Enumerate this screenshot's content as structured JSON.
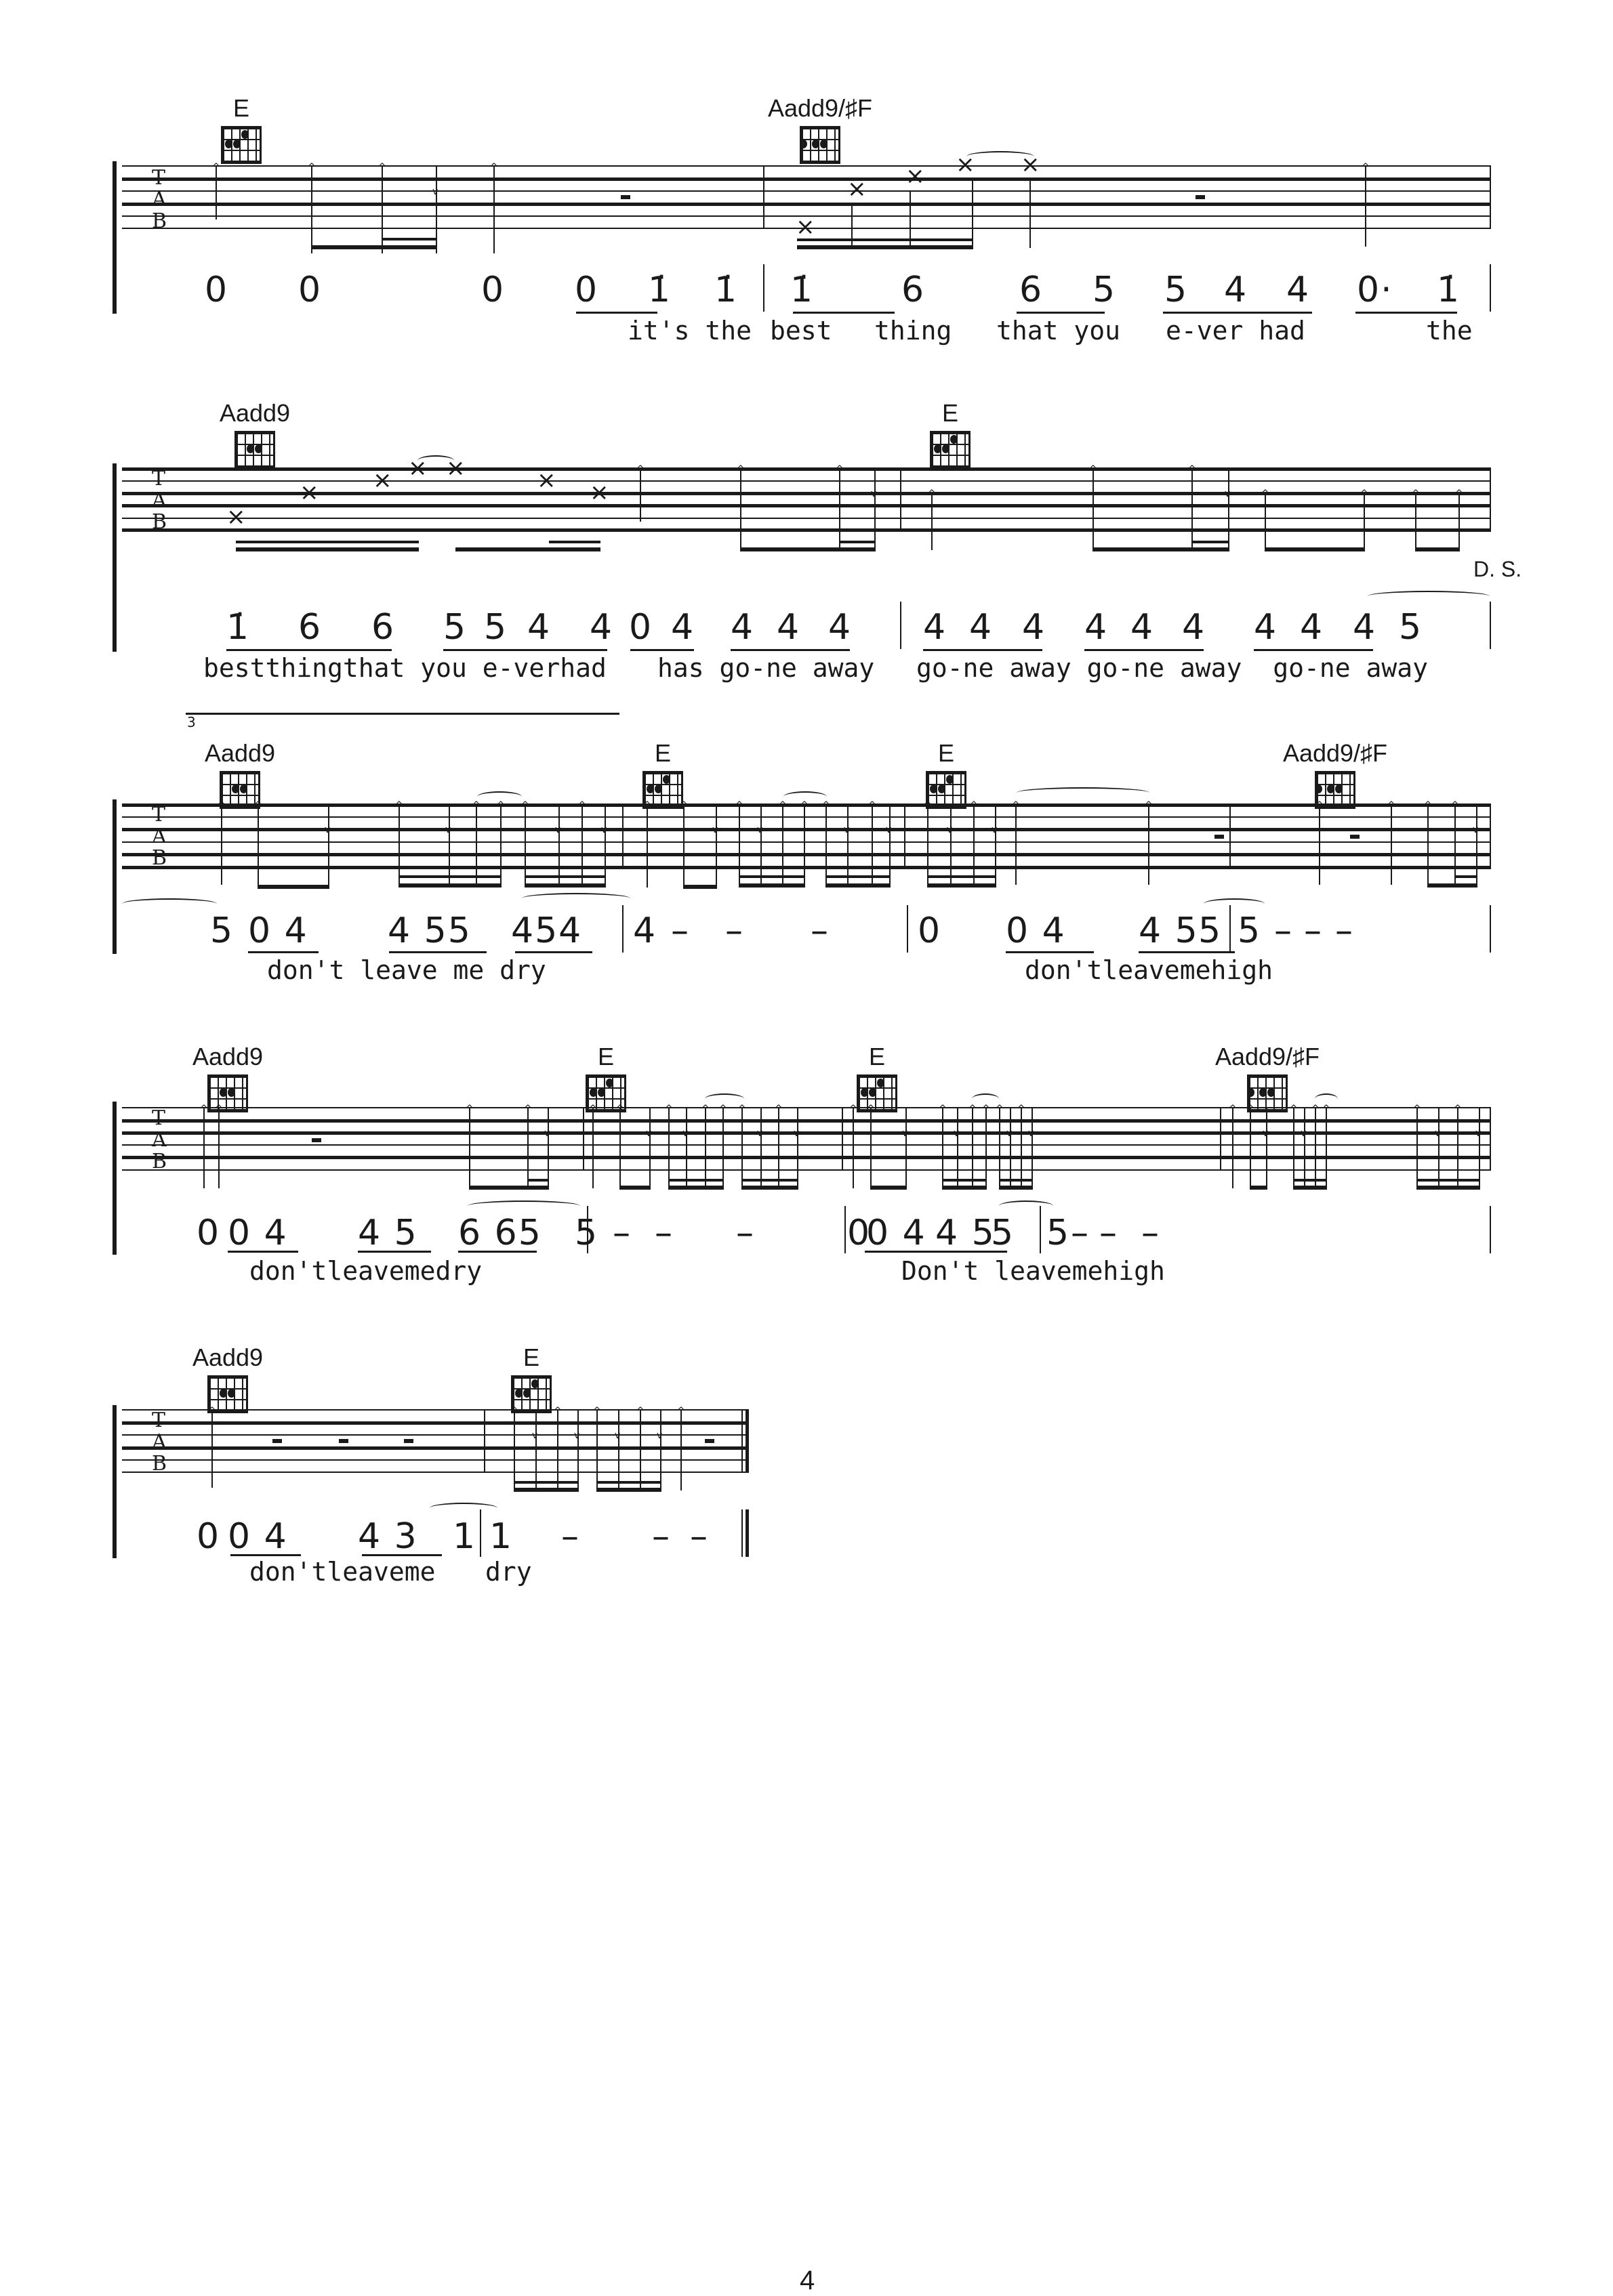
{
  "page": {
    "page_number": "4",
    "tab_clef": [
      "T",
      "A",
      "B"
    ],
    "ds_marking": "D. S.",
    "triplet_label": "3"
  },
  "systems": [
    {
      "chords": [
        {
          "name": "E",
          "diagram": "E"
        },
        {
          "name": "Aadd9/♯F",
          "diagram": "Aadd9/F#"
        }
      ],
      "measures": [
        {
          "notes": "0    0        0    0   i   i",
          "lyrics": "it's the best"
        },
        {
          "notes": "i     6     6   5   5  4   4   0·   i",
          "lyrics": "best   thing   that you   e-ver had        the"
        }
      ],
      "number_line": "0    0        0    0  1̇  1̇  | 1̇   6   6  5  5 4  4  0·  1̇",
      "lyric_line": "it's the  best   thing   that you   e-ver had       the"
    },
    {
      "chords": [
        {
          "name": "Aadd9",
          "diagram": "Aadd9"
        },
        {
          "name": "E",
          "diagram": "E"
        }
      ],
      "number_line": "1̇  6  6   5 5 4 4 0 4  4 4 4   | 4 4 4  4 4 4   4 4 4 5",
      "lyric_line": "bestthingthat you e-verhad  has go-ne away   go-ne away go-ne away  go-ne away",
      "ds": "D. S."
    },
    {
      "chords": [
        {
          "name": "Aadd9",
          "diagram": "Aadd9"
        },
        {
          "name": "E",
          "diagram": "E"
        },
        {
          "name": "E",
          "diagram": "E"
        },
        {
          "name": "Aadd9/♯F",
          "diagram": "Aadd9/F#"
        }
      ],
      "number_line": "5 0  4    4  55  454 | 4 –  –   –   | 0    0  4    4   5  5 | 5 – – –",
      "lyric_line": "don't leave me dry                       don'tleavemehigh"
    },
    {
      "chords": [
        {
          "name": "Aadd9",
          "diagram": "Aadd9"
        },
        {
          "name": "E",
          "diagram": "E"
        },
        {
          "name": "E",
          "diagram": "E"
        },
        {
          "name": "Aadd9/♯F",
          "diagram": "Aadd9/F#"
        }
      ],
      "number_line": "0 0  4    4  5  6 65 | 5 –  –   –  | 0 0  4    4  5  5  | 5 –  –   –",
      "lyric_line": "don'tleavemedry                  Don't leavemehigh"
    },
    {
      "chords": [
        {
          "name": "Aadd9",
          "diagram": "Aadd9"
        },
        {
          "name": "E",
          "diagram": "E"
        }
      ],
      "number_line": "0 0  4    4  31 | 1   –   – –",
      "lyric_line": "don'tleaveme  dry"
    }
  ],
  "text": {
    "s1_n": [
      "0",
      "0",
      "0",
      "0",
      "1̇",
      "1̇",
      "1̇",
      "6",
      "6",
      "5",
      "5",
      "4",
      "4",
      "0·",
      "1̇"
    ],
    "s1_l1": "it's the",
    "s1_l2": "best",
    "s1_l3": "thing",
    "s1_l4": "that you",
    "s1_l5": "e-ver had",
    "s1_l6": "the",
    "s2_n": [
      "1̇",
      "6",
      "6",
      "5",
      "5",
      "4",
      "4",
      "0",
      "4",
      "4",
      "4",
      "4",
      "4",
      "4",
      "4",
      "4",
      "4",
      "4",
      "4",
      "4",
      "4",
      "5"
    ],
    "s2_l1": "bestthingthat you e-verhad",
    "s2_l2": "has go-ne away",
    "s2_l3": "go-ne away go-ne away  go-ne away",
    "s3_n1": "5",
    "s3_n2": "0 4",
    "s3_n3": "4 55",
    "s3_n4": "454",
    "s3_n5": "4",
    "s3_n6": "–",
    "s3_n7": "0",
    "s3_n8": "0 4",
    "s3_n9": "4 5",
    "s3_n10": "5",
    "s3_n11": "5",
    "s3_l1": "don't leave me dry",
    "s3_l2": "don'tleavemehigh",
    "s4_n1": "0",
    "s4_n2": "0 4",
    "s4_n3": "4 5",
    "s4_n4": "6 65",
    "s4_n5": "5",
    "s4_n6": "0",
    "s4_n7": "0 4",
    "s4_n8": "4 5",
    "s4_n9": "5",
    "s4_n10": "5",
    "s4_l1": "don'tleavemedry",
    "s4_l2": "Don't leavemehigh",
    "s5_n1": "0",
    "s5_n2": "0 4",
    "s5_n3": "4 3",
    "s5_n4": "1",
    "s5_n5": "1",
    "s5_l1": "don'tleaveme",
    "s5_l2": "dry",
    "dash": "–"
  }
}
